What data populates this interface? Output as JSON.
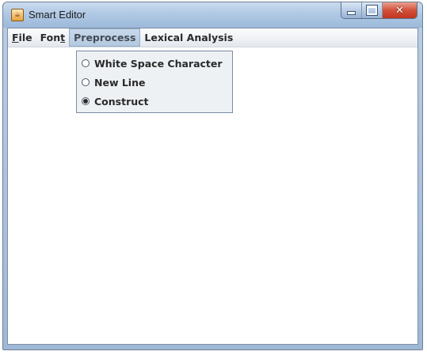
{
  "window": {
    "title": "Smart Editor"
  },
  "menubar": {
    "items": [
      {
        "label_underlined": "F",
        "label_rest": "ile"
      },
      {
        "label_prefix": "Fon",
        "label_underlined": "t"
      },
      {
        "label": "Preprocess",
        "active": true
      },
      {
        "label": "Lexical Analysis"
      }
    ]
  },
  "preprocess_menu": {
    "items": [
      {
        "label": "White Space Character",
        "selected": false
      },
      {
        "label": "New Line",
        "selected": false
      },
      {
        "label": "Construct",
        "selected": true
      }
    ]
  },
  "icons": {
    "app": "java-cup-icon",
    "minimize": "minimize-icon",
    "maximize": "maximize-icon",
    "close": "close-icon"
  },
  "colors": {
    "title_bar": "#aec7e3",
    "close_button": "#d3513a",
    "menu_highlight": "#b3c9e0"
  }
}
